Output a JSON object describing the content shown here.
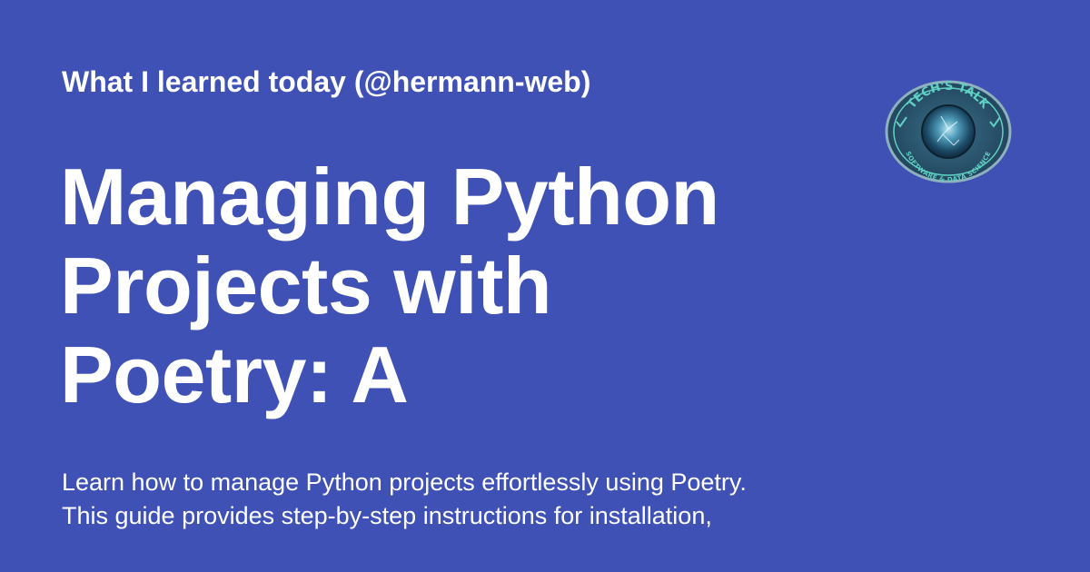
{
  "header": {
    "site_label": "What I learned today (@hermann-web)"
  },
  "post": {
    "title": "Managing Python Projects with Poetry: A",
    "description_lines": [
      "Learn how to manage Python projects effortlessly using Poetry.",
      "This guide provides step-by-step instructions for installation,"
    ]
  },
  "logo": {
    "top_text": "TECH'S TALK",
    "bottom_text": "SOFTWARE & DATA SCIENCE",
    "icon": "tech-talk-badge-icon"
  },
  "colors": {
    "background": "#3f51b5",
    "text": "#ffffff",
    "logo_teal": "#5fd0c4",
    "logo_ring": "#8fb0bd"
  }
}
